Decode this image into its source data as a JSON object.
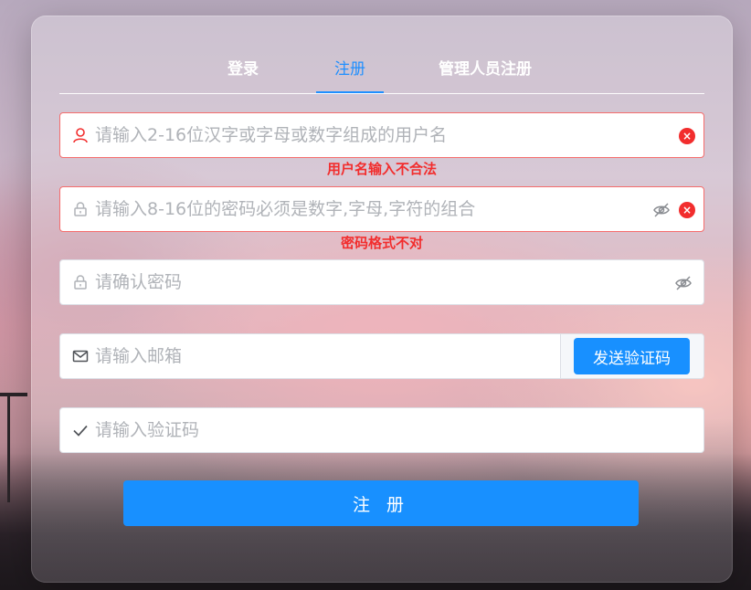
{
  "tabs": [
    {
      "label": "登录",
      "active": false
    },
    {
      "label": "注册",
      "active": true
    },
    {
      "label": "管理人员注册",
      "active": false
    }
  ],
  "form": {
    "username": {
      "placeholder": "请输入2-16位汉字或字母或数字组成的用户名",
      "value": "",
      "error": "用户名输入不合法"
    },
    "password": {
      "placeholder": "请输入8-16位的密码必须是数字,字母,字符的组合",
      "value": "",
      "error": "密码格式不对"
    },
    "confirm": {
      "placeholder": "请确认密码",
      "value": ""
    },
    "email": {
      "placeholder": "请输入邮箱",
      "value": "",
      "send_label": "发送验证码"
    },
    "code": {
      "placeholder": "请输入验证码",
      "value": ""
    },
    "submit_label": "注 册"
  },
  "colors": {
    "primary": "#1890ff",
    "error": "#f22d2d"
  }
}
